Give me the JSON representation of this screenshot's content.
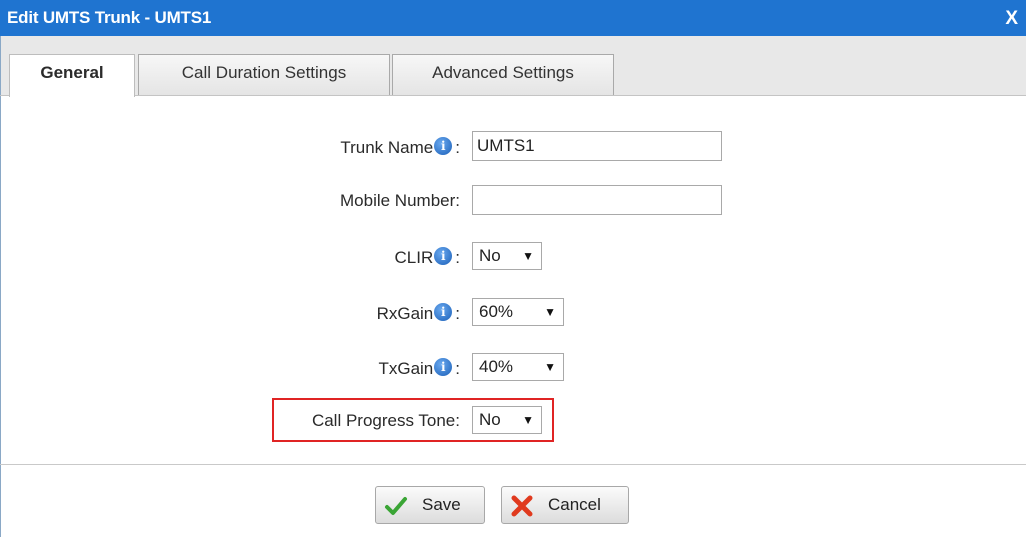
{
  "window": {
    "title": "Edit UMTS Trunk - UMTS1",
    "close_label": "X"
  },
  "tabs": [
    {
      "label": "General",
      "active": true
    },
    {
      "label": "Call Duration Settings",
      "active": false
    },
    {
      "label": "Advanced Settings",
      "active": false
    }
  ],
  "form": {
    "trunk_name": {
      "label": "Trunk Name",
      "value": "UMTS1",
      "info_icon": "info-icon"
    },
    "mobile_number": {
      "label": "Mobile Number:",
      "value": ""
    },
    "clir": {
      "label": "CLIR",
      "value": "No",
      "info_icon": "info-icon"
    },
    "rxgain": {
      "label": "RxGain",
      "value": "60%",
      "info_icon": "info-icon"
    },
    "txgain": {
      "label": "TxGain",
      "value": "40%",
      "info_icon": "info-icon"
    },
    "call_progress_tone": {
      "label": "Call Progress Tone:",
      "value": "No",
      "highlighted": true
    }
  },
  "buttons": {
    "save_label": "Save",
    "cancel_label": "Cancel"
  },
  "colors": {
    "title_bar": "#1f74d0",
    "highlight": "#e02424",
    "save_check": "#3aa535",
    "cancel_x": "#e03a1e"
  }
}
